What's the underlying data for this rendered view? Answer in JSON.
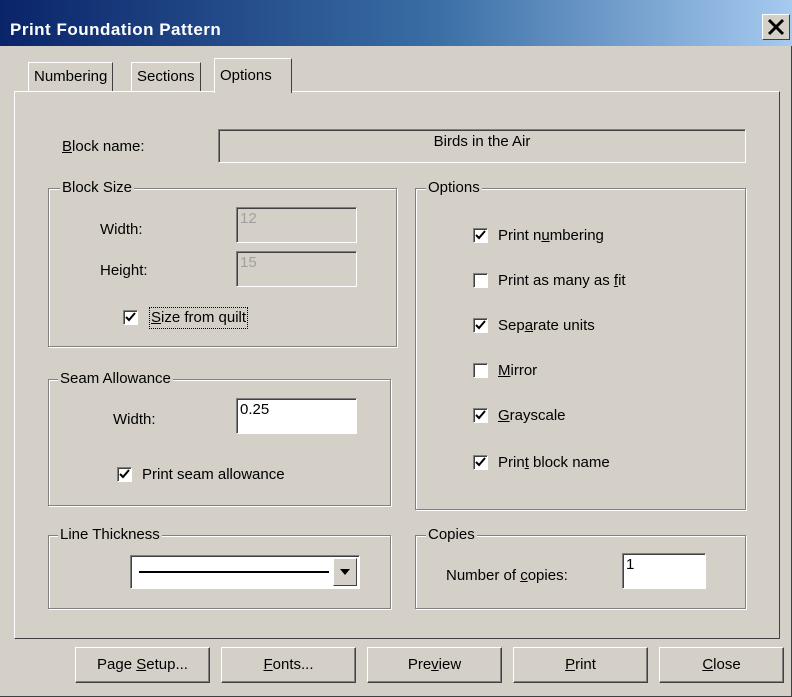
{
  "window": {
    "title": "Print Foundation Pattern",
    "close_icon": "close-icon"
  },
  "tabs": [
    {
      "label": "Numbering",
      "active": false
    },
    {
      "label": "Sections",
      "active": false
    },
    {
      "label": "Options",
      "active": true
    }
  ],
  "block_name": {
    "label": "Block name:",
    "value": "Birds in the Air"
  },
  "block_size": {
    "title": "Block Size",
    "width_label": "Width:",
    "width_value": "12",
    "height_label": "Height:",
    "height_value": "15",
    "size_from_quilt_label": "Size from quilt",
    "size_from_quilt_checked": true
  },
  "seam_allowance": {
    "title": "Seam Allowance",
    "width_label": "Width:",
    "width_value": "0.25",
    "print_label": "Print seam allowance",
    "print_checked": true
  },
  "line_thickness": {
    "title": "Line Thickness",
    "icon": "chevron-down-icon"
  },
  "options": {
    "title": "Options",
    "items": [
      {
        "label": "Print numbering",
        "checked": true
      },
      {
        "label": "Print as many as fit",
        "checked": false
      },
      {
        "label": "Separate units",
        "checked": true
      },
      {
        "label": "Mirror",
        "checked": false
      },
      {
        "label": "Grayscale",
        "checked": true
      },
      {
        "label": "Print block name",
        "checked": true
      }
    ]
  },
  "copies": {
    "title": "Copies",
    "label": "Number of copies:",
    "value": "1"
  },
  "buttons": {
    "page_setup": "Page Setup...",
    "fonts": "Fonts...",
    "preview": "Preview",
    "print": "Print",
    "close": "Close"
  }
}
